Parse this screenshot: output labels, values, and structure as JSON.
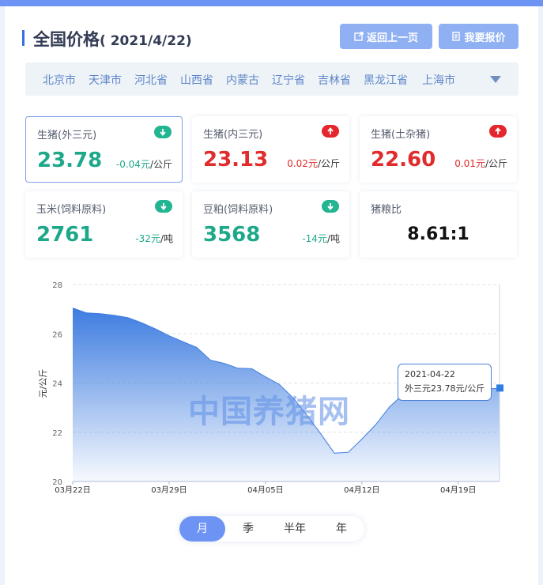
{
  "page": {
    "title": "全国价格",
    "date": "( 2021/4/22)",
    "buttons": {
      "back": "返回上一页",
      "quote": "我要报价"
    }
  },
  "regions": [
    "北京市",
    "天津市",
    "河北省",
    "山西省",
    "内蒙古",
    "辽宁省",
    "吉林省",
    "黑龙江省",
    "上海市"
  ],
  "cards": [
    {
      "name": "生猪(外三元)",
      "price": "23.78",
      "change": "-0.04元",
      "unit": "/公斤",
      "trend": "down"
    },
    {
      "name": "生猪(内三元)",
      "price": "23.13",
      "change": "0.02元",
      "unit": "/公斤",
      "trend": "up"
    },
    {
      "name": "生猪(土杂猪)",
      "price": "22.60",
      "change": "0.01元",
      "unit": "/公斤",
      "trend": "up"
    },
    {
      "name": "玉米(饲料原料)",
      "price": "2761",
      "change": "-32元",
      "unit": "/吨",
      "trend": "down"
    },
    {
      "name": "豆粕(饲料原料)",
      "price": "3568",
      "change": "-14元",
      "unit": "/吨",
      "trend": "down"
    },
    {
      "name": "猪粮比",
      "price": "8.61:1"
    }
  ],
  "watermark": "中国养猪网",
  "tooltip": {
    "date": "2021-04-22",
    "text": "外三元23.78元/公斤"
  },
  "tabs": [
    "月",
    "季",
    "半年",
    "年"
  ],
  "chart_data": {
    "type": "area",
    "ylabel": "元/公斤",
    "ylim": [
      20,
      28
    ],
    "yticks": [
      20,
      22,
      24,
      26,
      28
    ],
    "xticks": [
      "03月22日",
      "03月29日",
      "04月05日",
      "04月12日",
      "04月19日"
    ],
    "series": [
      {
        "x": [
          "03-22",
          "03-23",
          "03-24",
          "03-25",
          "03-26",
          "03-27",
          "03-28",
          "03-29",
          "03-30",
          "03-31",
          "04-01",
          "04-02",
          "04-03",
          "04-04",
          "04-05",
          "04-06",
          "04-07",
          "04-08",
          "04-09",
          "04-10",
          "04-11",
          "04-12",
          "04-13",
          "04-14",
          "04-15",
          "04-16",
          "04-17",
          "04-18",
          "04-19",
          "04-20",
          "04-21",
          "04-22"
        ],
        "values": [
          27.05,
          26.85,
          26.82,
          26.75,
          26.66,
          26.45,
          26.2,
          25.92,
          25.68,
          25.45,
          24.93,
          24.8,
          24.6,
          24.58,
          24.25,
          23.95,
          23.4,
          22.7,
          21.95,
          21.15,
          21.18,
          21.72,
          22.3,
          23.02,
          23.55,
          23.82,
          23.7,
          23.52,
          23.45,
          23.6,
          23.76,
          23.78
        ],
        "color": "#3d7ce0"
      }
    ],
    "highlight_color": "#2f7de0"
  }
}
